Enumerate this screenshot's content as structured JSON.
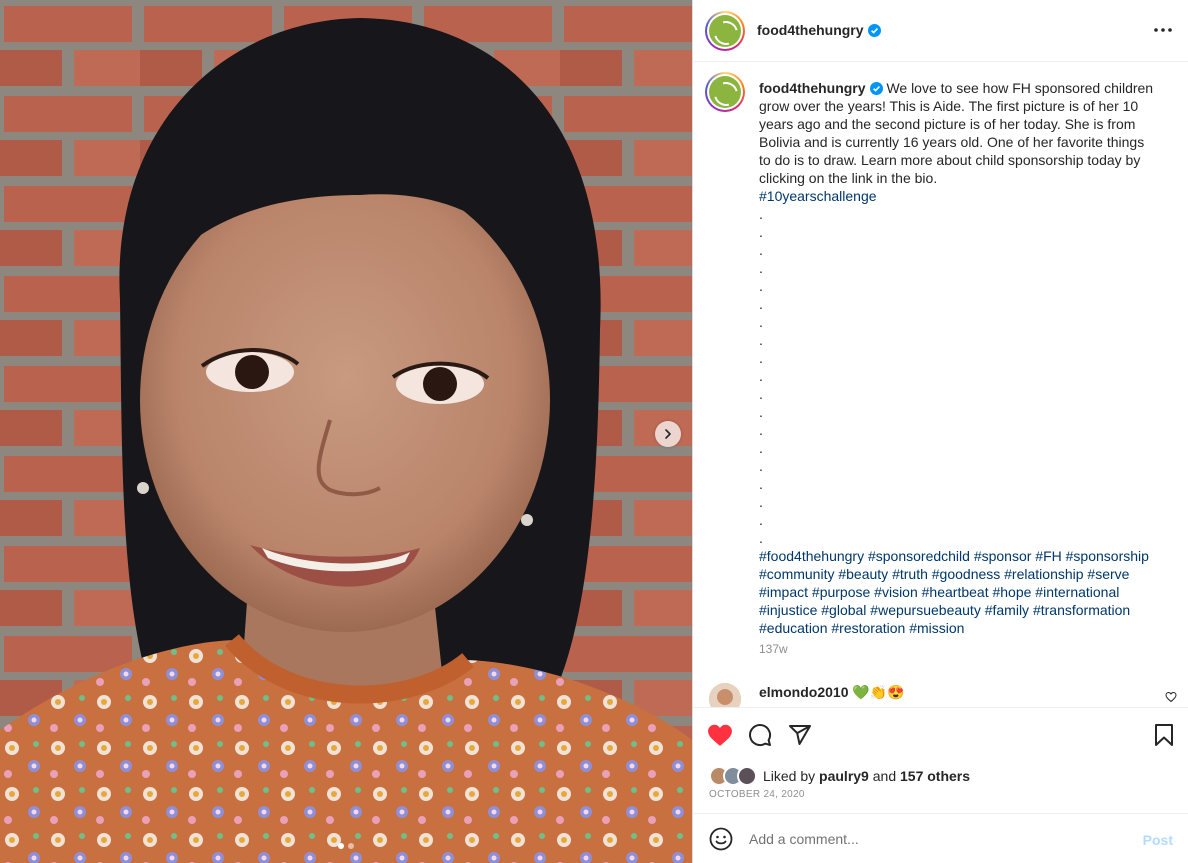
{
  "post": {
    "account": {
      "username": "food4thehungry",
      "verified": true,
      "logo_color": "#8bb53f"
    },
    "caption": {
      "text": "We love to see how FH sponsored children grow over the years! This is Aide. The first picture is of her 10 years ago and the second picture is of her today. She is from Bolivia and is currently 16 years old. One of her favorite things to do is to draw. Learn more about child sponsorship today by clicking on the link in the bio.",
      "first_hashtag": "#10yearschallenge",
      "spacer_dots": ".\n.\n.\n.\n.\n.\n.\n.\n.\n.\n.\n.\n.\n.\n.\n.\n.\n.\n.",
      "hashtags": "#food4thehungry #sponsoredchild #sponsor #FH #sponsorship #community #beauty #truth #goodness #relationship #serve #impact #purpose #vision #heartbeat #hope #international #injustice #global #wepursuebeauty #family #transformation #education #restoration #mission"
    },
    "time_ago": "137w",
    "comment": {
      "username": "elmondo2010",
      "text": "💚👏😍"
    },
    "likes": {
      "prefix": "Liked by",
      "first_user": "paulry9",
      "joiner": "and",
      "others": "157 others"
    },
    "date": "OCTOBER 24, 2020",
    "comment_input": {
      "placeholder": "Add a comment...",
      "post_label": "Post"
    },
    "media": {
      "slide_count": 2,
      "active_slide": 1
    },
    "icons": {
      "like": "heart-filled-icon",
      "comment": "speech-bubble-icon",
      "share": "paper-plane-icon",
      "save": "bookmark-icon",
      "more": "ellipsis-icon",
      "emoji": "smiley-icon"
    },
    "colors": {
      "like_red": "#ff3040",
      "hashtag_blue": "#00376b",
      "verified_blue": "#0095f6",
      "post_button_disabled": "#b3dbff"
    }
  }
}
